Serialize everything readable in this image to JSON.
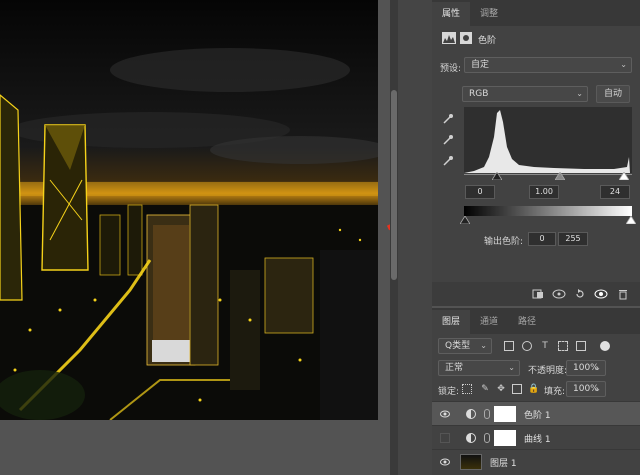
{
  "properties": {
    "tabs": [
      {
        "label": "属性"
      },
      {
        "label": "调整"
      }
    ],
    "panel_title": "色阶",
    "preset_label": "预设:",
    "preset_value": "自定",
    "channel_value": "RGB",
    "auto_label": "自动",
    "input_black": "0",
    "input_gamma": "1.00",
    "input_white": "24",
    "output_label": "输出色阶:",
    "output_black": "0",
    "output_white": "255"
  },
  "layers": {
    "tabs": [
      {
        "label": "图层"
      },
      {
        "label": "通道"
      },
      {
        "label": "路径"
      }
    ],
    "filter_label": "Q类型",
    "blend_mode": "正常",
    "opacity_label": "不透明度:",
    "opacity_value": "100%",
    "lock_label": "锁定:",
    "fill_label": "填充:",
    "fill_value": "100%",
    "items": [
      {
        "name": "色阶 1",
        "visible": true,
        "selected": true
      },
      {
        "name": "曲线 1",
        "visible": false,
        "selected": false
      },
      {
        "name": "图层 1",
        "visible": true,
        "selected": false
      }
    ]
  },
  "colors": {
    "panel_bg": "#424242",
    "accent_arrow": "#e8321e",
    "highlight_yellow": "#f5d21a"
  }
}
